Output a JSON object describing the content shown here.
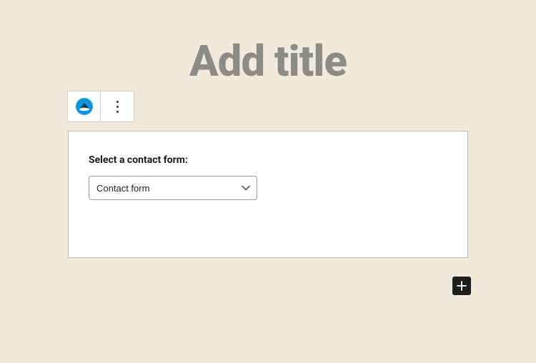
{
  "editor": {
    "title_placeholder": "Add title",
    "add_block_label": "Add block"
  },
  "toolbar": {
    "block_icon": "pirate-forms-icon",
    "more_label": "More options"
  },
  "block": {
    "label": "Select a contact form:",
    "select": {
      "selected": "Contact form",
      "options": [
        "Contact form"
      ]
    }
  },
  "colors": {
    "block_icon_fill": "#0f92d6",
    "block_icon_accent": "#0a6aa0"
  }
}
